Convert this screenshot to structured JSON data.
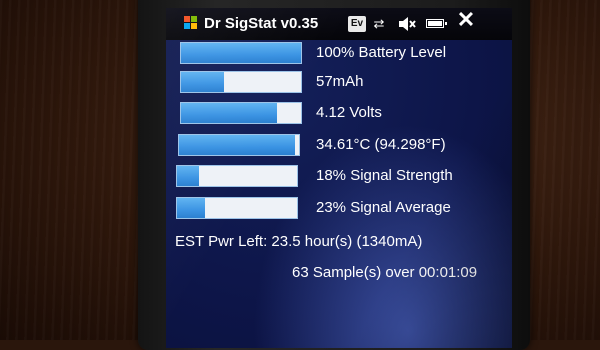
{
  "app": {
    "title": "Dr SigStat v0.35"
  },
  "tray": {
    "ev_label": "Ev",
    "icons": [
      "ev-icon",
      "sync-icon",
      "speaker-icon",
      "battery-icon",
      "close-icon"
    ],
    "battery_level": 1.0
  },
  "colors": {
    "bar_fill": "#3a93e3",
    "bar_track": "#eef2f7",
    "screen_bg": "#0d1548",
    "text": "#ffffff"
  },
  "stats": [
    {
      "label": "100% Battery Level",
      "level": 1.0
    },
    {
      "label": "57mAh",
      "level": 0.36
    },
    {
      "label": "4.12 Volts",
      "level": 0.8
    },
    {
      "label": "34.61°C (94.298°F)",
      "level": 0.97
    },
    {
      "label": "18% Signal Strength",
      "level": 0.18
    },
    {
      "label": "23% Signal Average",
      "level": 0.23
    }
  ],
  "status": {
    "est_power": "EST Pwr Left: 23.5 hour(s) (1340mA)",
    "samples": "63 Sample(s) over 00:01:09"
  }
}
